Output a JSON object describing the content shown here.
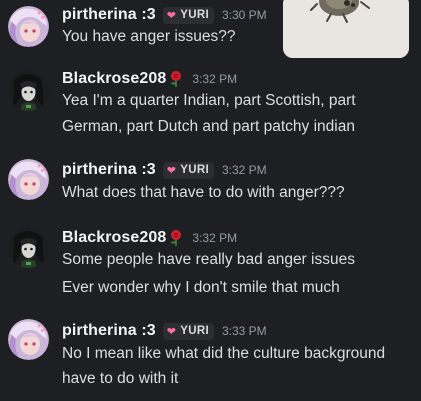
{
  "messages": [
    {
      "username": "pirtherina :3",
      "tag": "YURI",
      "time": "3:30 PM",
      "lines": [
        "You have anger issues??"
      ]
    },
    {
      "username": "Blackrose208",
      "time": "3:32 PM",
      "lines": [
        "Yea I'm a quarter Indian, part Scottish, part",
        "German, part Dutch and part patchy indian"
      ]
    },
    {
      "username": "pirtherina :3",
      "tag": "YURI",
      "time": "3:32 PM",
      "lines": [
        "What does that have to do with anger???"
      ]
    },
    {
      "username": "Blackrose208",
      "time": "3:32 PM",
      "lines": [
        "Some people have really bad anger issues",
        "Ever wonder why I don't smile that much"
      ]
    },
    {
      "username": "pirtherina :3",
      "tag": "YURI",
      "time": "3:33 PM",
      "lines": [
        "No I mean like what did the culture background",
        "have to do with it"
      ]
    }
  ],
  "icons": {
    "rose": "rose-emoji-icon",
    "heart": "heart-icon"
  },
  "colors": {
    "background": "#1e1f22",
    "username": "#f2f3f5",
    "text": "#dbdee1",
    "timestamp": "#949ba4",
    "tag_background": "#2b2d31",
    "heart": "#ff6ea8"
  }
}
